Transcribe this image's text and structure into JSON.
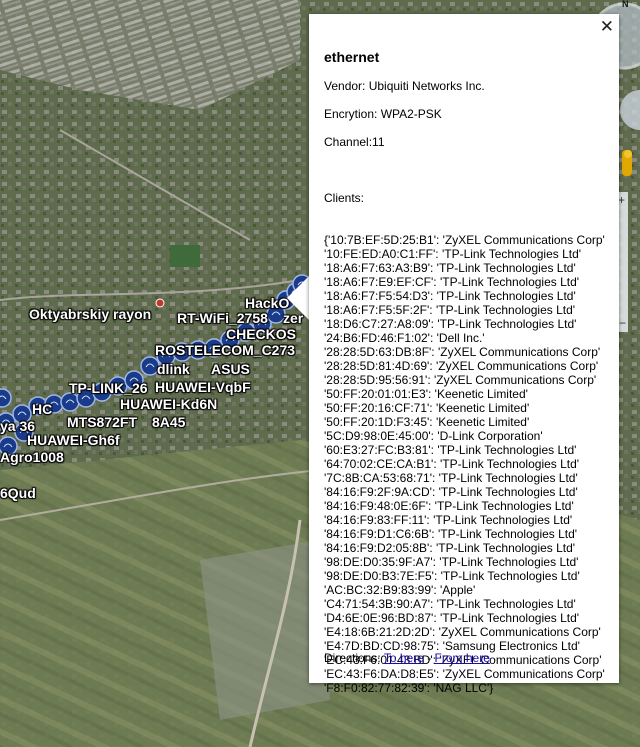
{
  "map": {
    "labels": [
      {
        "id": "oktyabrskiy",
        "text": "Oktyabrskiy rayon"
      },
      {
        "id": "rtwifi",
        "text": "RT-WiFi_2758"
      },
      {
        "id": "hacko",
        "text": "HackO"
      },
      {
        "id": "zer",
        "text": "zer"
      },
      {
        "id": "checkos",
        "text": "CHECKOS"
      },
      {
        "id": "rostelecom",
        "text": "ROSTELECOM_C273"
      },
      {
        "id": "dlink",
        "text": "dlink"
      },
      {
        "id": "asus",
        "text": "ASUS"
      },
      {
        "id": "tplink26",
        "text": "TP-LINK_26"
      },
      {
        "id": "huaweivqbf",
        "text": "HUAWEI-VqbF"
      },
      {
        "id": "huaweikd6n",
        "text": "HUAWEI-Kd6N"
      },
      {
        "id": "hc",
        "text": "HC"
      },
      {
        "id": "mts",
        "text": "MTS872FT"
      },
      {
        "id": "8a45",
        "text": "8A45"
      },
      {
        "id": "ya36",
        "text": "ya 36"
      },
      {
        "id": "huaweigh6f",
        "text": "HUAWEI-Gh6f"
      },
      {
        "id": "agro",
        "text": "Agro1008"
      },
      {
        "id": "qud",
        "text": "6Qud"
      }
    ],
    "compass_letter": "N",
    "colors": {
      "marker": "#1a3a8a",
      "label": "#ffffff"
    }
  },
  "popup": {
    "title": "ethernet",
    "vendor": "Vendor: Ubiquiti Networks Inc.",
    "encryption": "Encrytion: WPA2-PSK",
    "channel": "Channel:11",
    "clients_label": "Clients:",
    "clients": [
      "{'10:7B:EF:5D:25:B1': 'ZyXEL Communications Corp'",
      "'10:FE:ED:A0:C1:FF': 'TP-Link Technologies Ltd'",
      "'18:A6:F7:63:A3:B9': 'TP-Link Technologies Ltd'",
      "'18:A6:F7:E9:EF:CF': 'TP-Link Technologies Ltd'",
      "'18:A6:F7:F5:54:D3': 'TP-Link Technologies Ltd'",
      "'18:A6:F7:F5:5F:2F': 'TP-Link Technologies Ltd'",
      "'18:D6:C7:27:A8:09': 'TP-Link Technologies Ltd'",
      "'24:B6:FD:46:F1:02': 'Dell Inc.'",
      "'28:28:5D:63:DB:8F': 'ZyXEL Communications Corp'",
      "'28:28:5D:81:4D:69': 'ZyXEL Communications Corp'",
      "'28:28:5D:95:56:91': 'ZyXEL Communications Corp'",
      "'50:FF:20:01:01:E3': 'Keenetic Limited'",
      "'50:FF:20:16:CF:71': 'Keenetic Limited'",
      "'50:FF:20:1D:F3:45': 'Keenetic Limited'",
      "'5C:D9:98:0E:45:00': 'D-Link Corporation'",
      "'60:E3:27:FC:B3:81': 'TP-Link Technologies Ltd'",
      "'64:70:02:CE:CA:B1': 'TP-Link Technologies Ltd'",
      "'7C:8B:CA:53:68:71': 'TP-Link Technologies Ltd'",
      "'84:16:F9:2F:9A:CD': 'TP-Link Technologies Ltd'",
      "'84:16:F9:48:0E:6F': 'TP-Link Technologies Ltd'",
      "'84:16:F9:83:FF:11': 'TP-Link Technologies Ltd'",
      "'84:16:F9:D1:C6:6B': 'TP-Link Technologies Ltd'",
      "'84:16:F9:D2:05:8B': 'TP-Link Technologies Ltd'",
      "'98:DE:D0:35:9F:A7': 'TP-Link Technologies Ltd'",
      "'98:DE:D0:B3:7E:F5': 'TP-Link Technologies Ltd'",
      "'AC:BC:32:B9:83:99': 'Apple'",
      "'C4:71:54:3B:90:A7': 'TP-Link Technologies Ltd'",
      "'D4:6E:0E:96:BD:87': 'TP-Link Technologies Ltd'",
      "'E4:18:6B:21:2D:2D': 'ZyXEL Communications Corp'",
      "'E4:7D:BD:CD:98:75': 'Samsung Electronics Ltd'",
      "'EC:43:F6:01:43:BD': 'ZyXEL Communications Corp'",
      "'EC:43:F6:DA:D8:E5': 'ZyXEL Communications Corp'",
      "'F8:F0:82:77:82:39': 'NAG LLC'}"
    ],
    "directions_label": "Directions:",
    "to_here": "To here",
    "separator": "-",
    "from_here": "From here",
    "close_glyph": "✕"
  }
}
